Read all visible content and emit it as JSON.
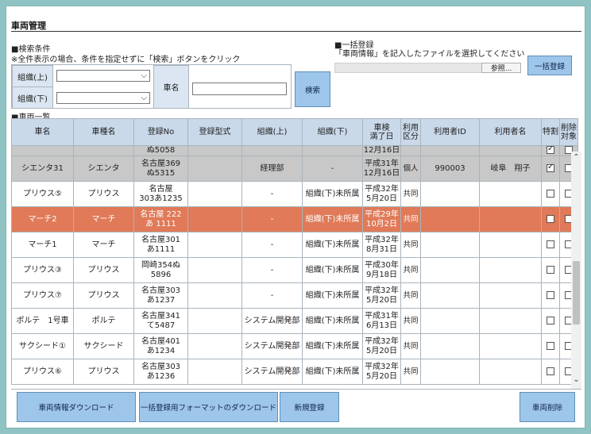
{
  "page_title": "車両管理",
  "search": {
    "heading": "■検索条件",
    "note": "※全件表示の場合、条件を指定せずに「検索」ボタンをクリック",
    "org_upper_label": "組織(上)",
    "org_lower_label": "組織(下)",
    "car_name_label": "車名",
    "org_upper_value": "",
    "org_lower_value": "",
    "car_name_value": "",
    "search_button": "検索"
  },
  "bulk": {
    "heading": "■一括登録",
    "note": "「車両情報」を記入したファイルを選択してください",
    "browse_button": "参照...",
    "register_button": "一括登録"
  },
  "list_heading": "■車両一覧",
  "table": {
    "headers": [
      "車名",
      "車種名",
      "登録No",
      "登録型式",
      "組織(上)",
      "組織(下)",
      "車検\n満了日",
      "利用\n区分",
      "利用者ID",
      "利用者名",
      "特割",
      "削除\n対象"
    ],
    "rows": [
      {
        "style": "gray",
        "cells": [
          "",
          "",
          "ぬ5058",
          "",
          "",
          "",
          "12月16日",
          "",
          "",
          "",
          "",
          ""
        ],
        "tokuwari": true,
        "sakujo": false,
        "partial": true
      },
      {
        "style": "gray",
        "cells": [
          "シエンタ31",
          "シエンタ",
          "名古屋369\nぬ5315",
          "",
          "経理部",
          "-",
          "平成31年\n12月16日",
          "個人",
          "990003",
          "岐阜　翔子"
        ],
        "tokuwari": true,
        "sakujo": false
      },
      {
        "style": "white",
        "cells": [
          "プリウス⑤",
          "プリウス",
          "名古屋\n303あ1235",
          "",
          "-",
          "組織(下)未所属",
          "平成32年\n5月20日",
          "共同",
          "",
          ""
        ],
        "tokuwari": false,
        "sakujo": false
      },
      {
        "style": "orange",
        "cells": [
          "マーチ2",
          "マーチ",
          "名古屋 222\nあ 1111",
          "",
          "-",
          "組織(下)未所属",
          "平成29年\n10月2日",
          "共同",
          "",
          ""
        ],
        "tokuwari": false,
        "sakujo": false
      },
      {
        "style": "white",
        "cells": [
          "マーチ1",
          "マーチ",
          "名古屋301\nあ1111",
          "",
          "-",
          "組織(下)未所属",
          "平成32年\n8月31日",
          "共同",
          "",
          ""
        ],
        "tokuwari": false,
        "sakujo": false
      },
      {
        "style": "white",
        "cells": [
          "プリウス③",
          "プリウス",
          "岡崎354ぬ\n5896",
          "",
          "-",
          "組織(下)未所属",
          "平成30年\n9月18日",
          "共同",
          "",
          ""
        ],
        "tokuwari": false,
        "sakujo": false
      },
      {
        "style": "white",
        "cells": [
          "プリウス⑦",
          "プリウス",
          "名古屋303\nあ1237",
          "",
          "-",
          "組織(下)未所属",
          "平成32年\n5月20日",
          "共同",
          "",
          ""
        ],
        "tokuwari": false,
        "sakujo": false
      },
      {
        "style": "white",
        "cells": [
          "ポルテ　1号車",
          "ポルテ",
          "名古屋341\nて5487",
          "",
          "システム開発部",
          "組織(下)未所属",
          "平成31年\n6月13日",
          "共同",
          "",
          ""
        ],
        "tokuwari": false,
        "sakujo": false
      },
      {
        "style": "white",
        "cells": [
          "サクシード①",
          "サクシード",
          "名古屋401\nあ1234",
          "",
          "システム開発部",
          "組織(下)未所属",
          "平成32年\n5月20日",
          "共同",
          "",
          ""
        ],
        "tokuwari": false,
        "sakujo": false
      },
      {
        "style": "white",
        "cells": [
          "プリウス⑥",
          "プリウス",
          "名古屋303\nあ1236",
          "",
          "システム開発部",
          "組織(下)未所属",
          "平成32年\n5月20日",
          "共同",
          "",
          ""
        ],
        "tokuwari": false,
        "sakujo": false
      }
    ]
  },
  "footer": {
    "download_info": "車両情報ダウンロード",
    "download_format": "一括登録用フォーマットのダウンロード",
    "new_register": "新規登録",
    "delete_vehicle": "車両削除"
  },
  "colors": {
    "header_bg": "#c9d9ea",
    "button_bg": "#9dc6ea",
    "highlight_row": "#e07a58",
    "selected_row": "#c8c8c8"
  }
}
